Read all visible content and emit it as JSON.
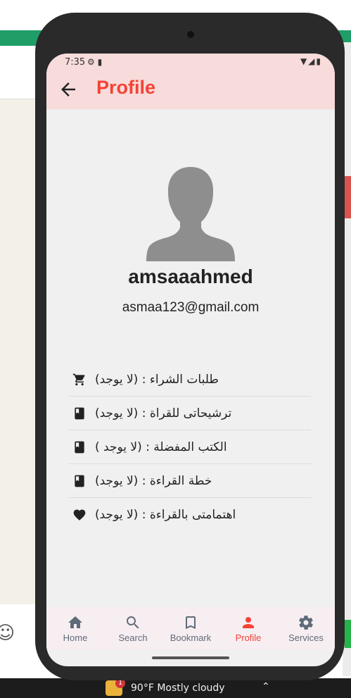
{
  "status_bar": {
    "time": "7:35"
  },
  "app_bar": {
    "title": "Profile"
  },
  "profile": {
    "username": "amsaaahmed",
    "email": "asmaa123@gmail.com"
  },
  "items": [
    {
      "icon": "cart-icon",
      "label": "طلبات الشراء : (لا يوجد)"
    },
    {
      "icon": "book-icon",
      "label": "ترشيحاتى للقراة : (لا يوجد)"
    },
    {
      "icon": "book-icon",
      "label": "الكتب المفضلة : (لا يوجد )"
    },
    {
      "icon": "book-icon",
      "label": "خطة القراءة : (لا يوجد)"
    },
    {
      "icon": "heart-icon",
      "label": "اهتمامتى بالقراءة : (لا يوجد)"
    }
  ],
  "nav": [
    {
      "label": "Home",
      "icon": "home-icon",
      "active": false
    },
    {
      "label": "Search",
      "icon": "search-icon",
      "active": false
    },
    {
      "label": "Bookmark",
      "icon": "bookmark-icon",
      "active": false
    },
    {
      "label": "Profile",
      "icon": "person-icon",
      "active": true
    },
    {
      "label": "Services",
      "icon": "gear-icon",
      "active": false
    }
  ],
  "taskbar": {
    "weather": "90°F  Mostly cloudy",
    "badge": "1"
  },
  "colors": {
    "accent": "#f44336",
    "appbar": "#f7dcdb",
    "nav_bg": "#f7eef2",
    "inactive": "#5f6b78"
  }
}
